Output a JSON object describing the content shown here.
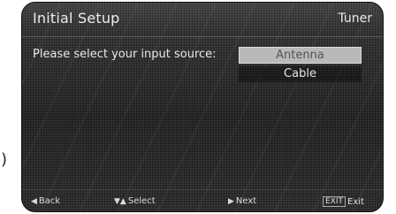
{
  "stray_char": ")",
  "screen": {
    "title": "Initial Setup",
    "section": "Tuner",
    "prompt": "Please select your input source:",
    "options": [
      {
        "label": "Antenna",
        "selected": true
      },
      {
        "label": "Cable",
        "selected": false
      }
    ],
    "footer": {
      "back_label": "Back",
      "select_label": "Select",
      "next_label": "Next",
      "exit_key": "EXIT",
      "exit_label": "Exit"
    },
    "icons": {
      "back": "left-arrow-icon",
      "select": "up-down-arrow-icon",
      "next": "right-arrow-icon"
    }
  }
}
